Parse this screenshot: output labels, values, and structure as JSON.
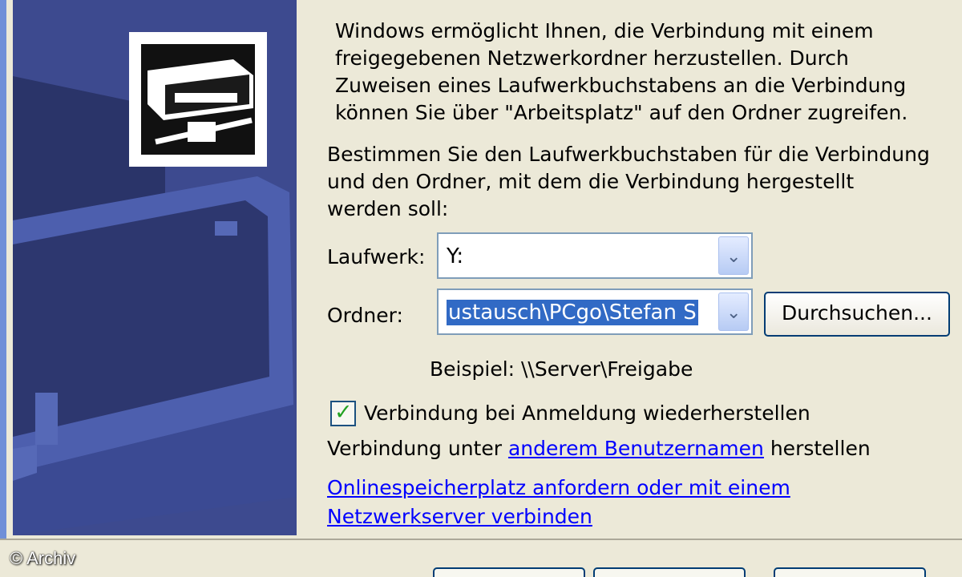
{
  "dialog": {
    "intro": "Windows ermöglicht Ihnen, die Verbindung mit einem\nfreigegebenen Netzwerkordner herzustellen. Durch\nZuweisen eines Laufwerkbuchstabens an die Verbindung\nkönnen Sie über \"Arbeitsplatz\" auf den Ordner zugreifen.",
    "instruction": "Bestimmen Sie den Laufwerkbuchstaben für die Verbindung\nund den Ordner, mit dem die Verbindung hergestellt\nwerden soll:",
    "drive": {
      "label": "Laufwerk:",
      "value": "Y:"
    },
    "folder": {
      "label": "Ordner:",
      "value": "ustausch\\PCgo\\Stefan S"
    },
    "browse_label": "Durchsuchen...",
    "example": "Beispiel: \\\\Server\\Freigabe",
    "reconnect": {
      "label": "Verbindung bei Anmeldung wiederherstellen",
      "checked": true
    },
    "other_user": {
      "prefix": "Verbindung unter ",
      "link": "anderem Benutzernamen",
      "suffix": " herstellen"
    },
    "online_link": {
      "line1": "Onlinespeicherplatz anfordern oder mit einem",
      "line2": "Netzwerkserver verbinden"
    }
  },
  "watermark": "© Archiv",
  "colors": {
    "side_panel": "#3d4a8f",
    "selection": "#316ac5",
    "link": "#0000ff",
    "check": "#21a121"
  }
}
